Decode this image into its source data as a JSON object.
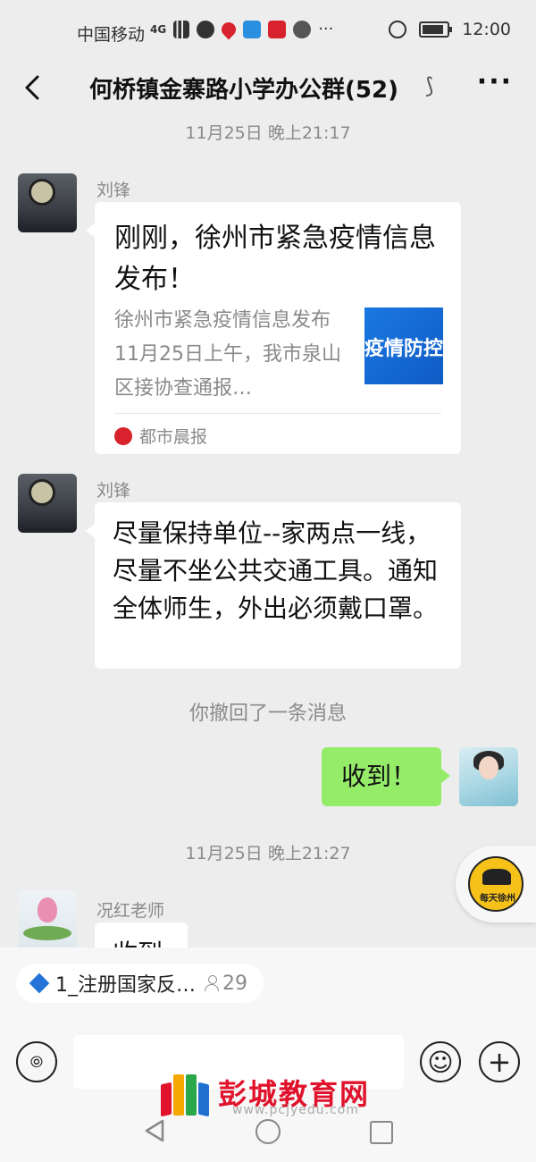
{
  "status_bar": {
    "carrier": "中国移动",
    "network": "4G",
    "time": "12:00"
  },
  "header": {
    "title": "何桥镇金寨路小学办公群(52)",
    "more": "···"
  },
  "chat": {
    "timestamp_1": "11月25日 晚上21:17",
    "msg1": {
      "sender": "刘锋",
      "card_title": "刚刚，徐州市紧急疫情信息发布！",
      "card_desc": "徐州市紧急疫情信息发布11月25日上午，我市泉山区接协查通报…",
      "thumb_text": "疫情防控",
      "source": "都市晨报"
    },
    "msg2": {
      "sender": "刘锋",
      "text": "尽量保持单位--家两点一线，尽量不坐公共交通工具。通知全体师生，外出必须戴口罩。"
    },
    "recall_notice": "你撤回了一条消息",
    "my_msg": {
      "text": "收到！"
    },
    "timestamp_2": "11月25日 晚上21:27",
    "msg3": {
      "sender": "况红老师",
      "text": "收到"
    },
    "float_badge": "每天徐州"
  },
  "pinned": {
    "label": "1_注册国家反…",
    "count": "29"
  },
  "input": {
    "placeholder": ""
  },
  "watermark": {
    "site_name": "彭城教育网",
    "url": "www.pcjyedu.com"
  },
  "colors": {
    "my_bubble": "#95ec69",
    "background": "#ededed",
    "watermark": "#e0122c"
  }
}
